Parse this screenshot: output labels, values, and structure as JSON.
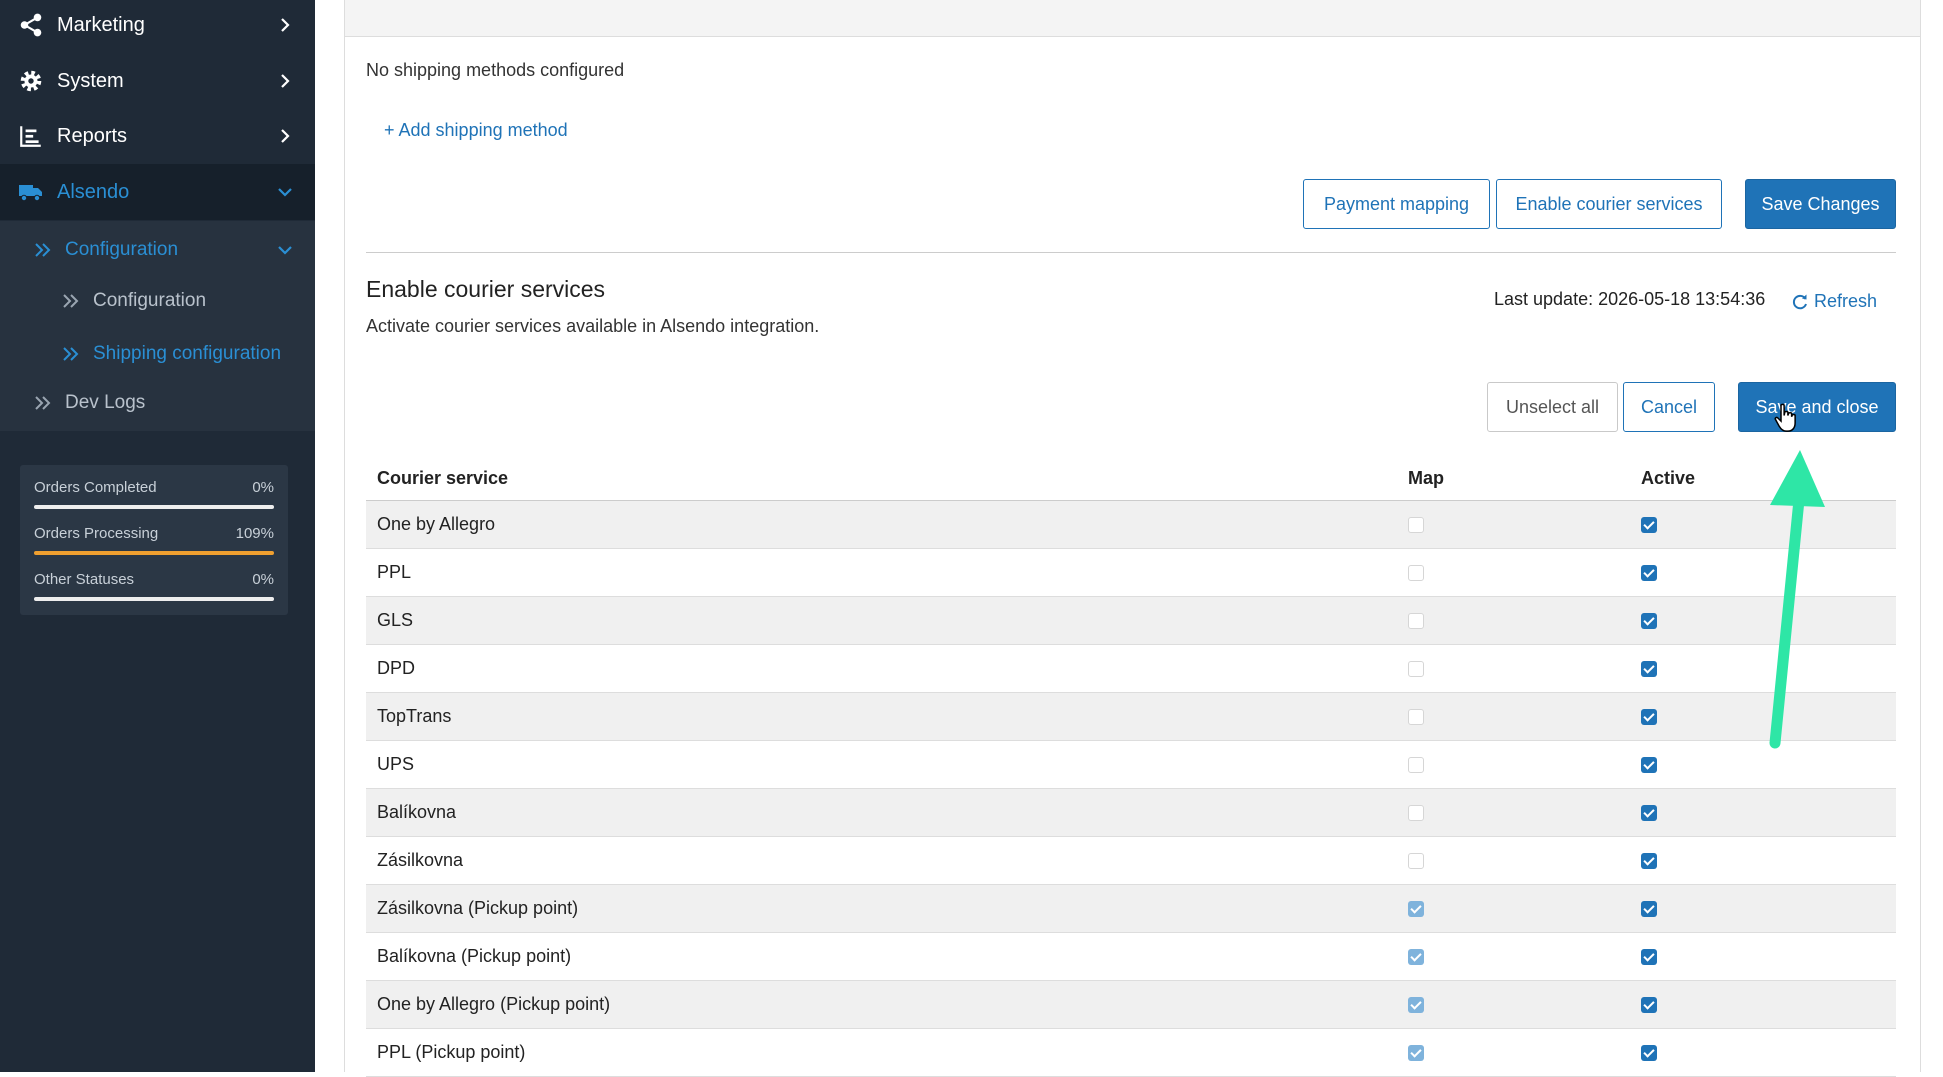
{
  "sidebar": {
    "items": [
      {
        "label": "Marketing",
        "icon": "share-icon"
      },
      {
        "label": "System",
        "icon": "gear-icon"
      },
      {
        "label": "Reports",
        "icon": "bar-chart-icon"
      },
      {
        "label": "Alsendo",
        "icon": "truck-icon"
      }
    ],
    "sub": {
      "configuration": "Configuration",
      "configuration_child": "Configuration",
      "shipping": "Shipping configuration",
      "dev_logs": "Dev Logs"
    },
    "stats": [
      {
        "label": "Orders Completed",
        "pct": "0%",
        "level": 0,
        "color": "#ffffff"
      },
      {
        "label": "Orders Processing",
        "pct": "109%",
        "level": 1.0,
        "color": "#f0a030"
      },
      {
        "label": "Other Statuses",
        "pct": "0%",
        "level": 0,
        "color": "#ffffff"
      }
    ]
  },
  "shipping": {
    "empty_text": "No shipping methods configured",
    "add_link": "+ Add shipping method",
    "payment_mapping": "Payment mapping",
    "enable_courier": "Enable courier services",
    "save_changes": "Save Changes"
  },
  "courier": {
    "title": "Enable courier services",
    "description": "Activate courier services available in Alsendo integration.",
    "last_update": "Last update: 2026-05-18 13:54:36",
    "refresh": "Refresh",
    "unselect_all": "Unselect all",
    "cancel": "Cancel",
    "save_close": "Save and close",
    "columns": {
      "service": "Courier service",
      "map": "Map",
      "active": "Active"
    },
    "rows": [
      {
        "name": "One by Allegro",
        "map": false,
        "active": true
      },
      {
        "name": "PPL",
        "map": false,
        "active": true
      },
      {
        "name": "GLS",
        "map": false,
        "active": true
      },
      {
        "name": "DPD",
        "map": false,
        "active": true
      },
      {
        "name": "TopTrans",
        "map": false,
        "active": true
      },
      {
        "name": "UPS",
        "map": false,
        "active": true
      },
      {
        "name": "Balíkovna",
        "map": false,
        "active": true
      },
      {
        "name": "Zásilkovna",
        "map": false,
        "active": true
      },
      {
        "name": "Zásilkovna (Pickup point)",
        "map": true,
        "active": true
      },
      {
        "name": "Balíkovna (Pickup point)",
        "map": true,
        "active": true
      },
      {
        "name": "One by Allegro (Pickup point)",
        "map": true,
        "active": true
      },
      {
        "name": "PPL (Pickup point)",
        "map": true,
        "active": true
      }
    ]
  },
  "colors": {
    "accent": "#1f73b7",
    "sidebar": "#1f2a37",
    "arrow": "#2ee6a6"
  }
}
